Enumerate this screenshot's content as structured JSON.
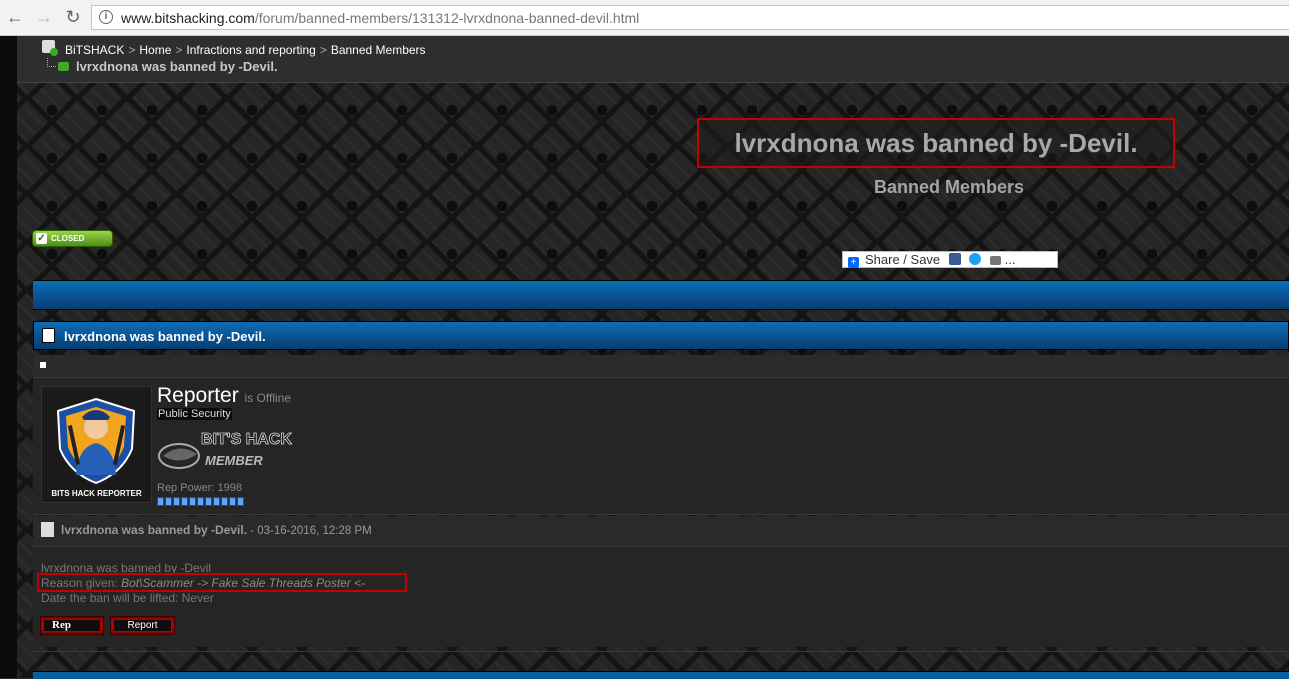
{
  "browser": {
    "url_domain": "www.bitshacking.com",
    "url_path": "/forum/banned-members/131312-lvrxdnona-banned-devil.html",
    "back_icon": "arrow-left-icon",
    "forward_icon": "arrow-right-icon",
    "reload_icon": "reload-icon"
  },
  "breadcrumb": {
    "items": [
      "BiTSHACK",
      "Home",
      "Infractions and reporting",
      "Banned Members"
    ],
    "separator": ">",
    "current": "lvrxdnona was banned by -Devil."
  },
  "header": {
    "thread_title": "lvrxdnona was banned by -Devil.",
    "forum_name": "Banned Members",
    "closed_badge": "CLOSED",
    "share_label": "Share / Save",
    "share_more": "..."
  },
  "post": {
    "head_title": "lvrxdnona was banned by -Devil.",
    "username": "Reporter",
    "status": "is Offline",
    "user_title": "Public Security",
    "avatar_caption": "BITS HACK REPORTER",
    "rank_text_top": "BIT'S HACK",
    "rank_text_bottom": "MEMBER",
    "rep_power": "Rep Power: 1998",
    "rep_blocks": 11,
    "meta_title": "lvrxdnona was banned by -Devil.",
    "meta_date": " - 03-16-2016, 12:28 PM",
    "body_line1": "lvrxdnona was banned by -Devil",
    "reason_label": "Reason given: ",
    "reason_value": "Bot\\Scammer -> Fake Sale Threads Poster <-",
    "body_line3": "Date the ban will be lifted: Never",
    "rep_button": "Rep",
    "report_button": "Report"
  },
  "colors": {
    "accent_red": "#c40000",
    "header_blue": "#0a5fa0",
    "closed_green": "#4b8f15"
  }
}
